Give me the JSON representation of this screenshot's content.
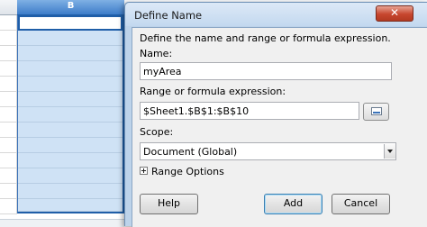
{
  "spreadsheet": {
    "column_b_header": "B"
  },
  "dialog": {
    "title": "Define Name",
    "close_glyph": "✕",
    "description": "Define the name and range or formula expression.",
    "name_label": "Name:",
    "name_value": "myArea",
    "range_label": "Range or formula expression:",
    "range_value": "$Sheet1.$B$1:$B$10",
    "range_button_icon": "shrink-dialog-icon",
    "scope_label": "Scope:",
    "scope_value": "Document (Global)",
    "range_options_label": "Range Options",
    "help_button": "Help",
    "add_button": "Add",
    "cancel_button": "Cancel"
  }
}
